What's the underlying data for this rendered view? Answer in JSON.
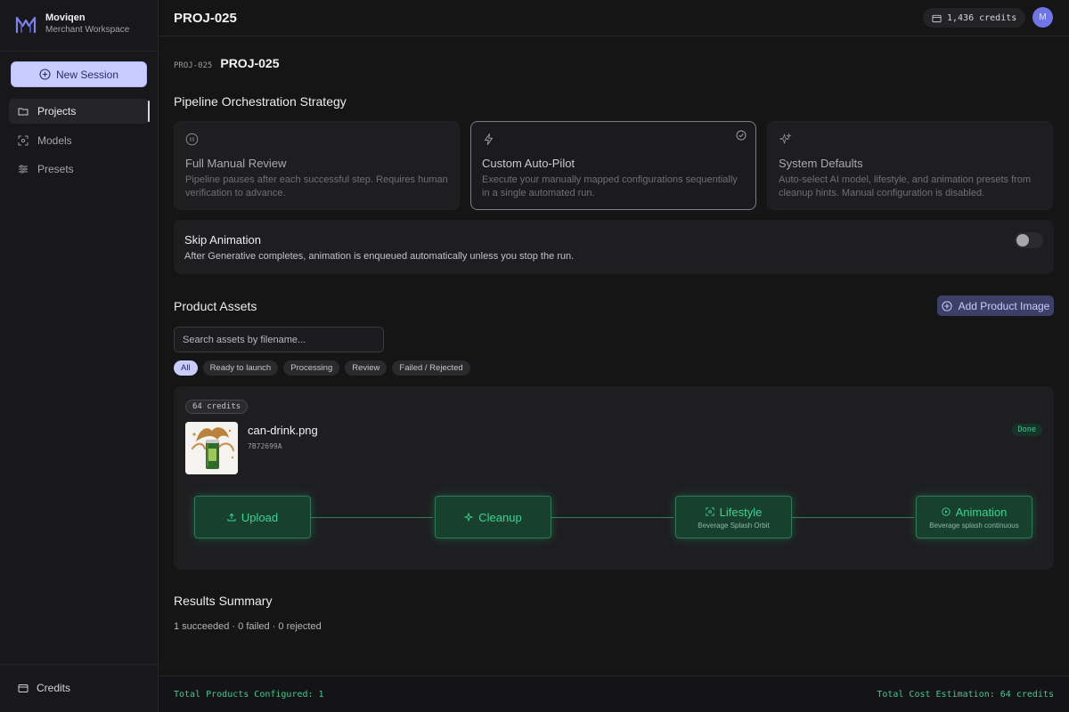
{
  "brand": {
    "name": "Moviqen",
    "subtitle": "Merchant Workspace"
  },
  "sidebar": {
    "new_session_label": "New Session",
    "items": [
      {
        "label": "Projects",
        "icon": "folder-icon",
        "active": true
      },
      {
        "label": "Models",
        "icon": "scan-icon",
        "active": false
      },
      {
        "label": "Presets",
        "icon": "sliders-icon",
        "active": false
      }
    ],
    "credits_label": "Credits"
  },
  "topbar": {
    "title": "PROJ-025",
    "credits": "1,436 credits",
    "avatar_initial": "M"
  },
  "breadcrumb": {
    "code": "PROJ-025",
    "title": "PROJ-025"
  },
  "strategy": {
    "title": "Pipeline Orchestration Strategy",
    "options": [
      {
        "title": "Full Manual Review",
        "description": "Pipeline pauses after each successful step. Requires human verification to advance.",
        "icon": "pause-icon",
        "selected": false
      },
      {
        "title": "Custom Auto-Pilot",
        "description": "Execute your manually mapped configurations sequentially in a single automated run.",
        "icon": "lightning-icon",
        "selected": true
      },
      {
        "title": "System Defaults",
        "description": "Auto-select AI model, lifestyle, and animation presets from cleanup hints. Manual configuration is disabled.",
        "icon": "sparkles-icon",
        "selected": false
      }
    ]
  },
  "skip_animation": {
    "title": "Skip Animation",
    "description": "After Generative completes, animation is enqueued automatically unless you stop the run.",
    "enabled": false
  },
  "assets": {
    "title": "Product Assets",
    "add_label": "Add Product Image",
    "search_placeholder": "Search assets by filename...",
    "filters": [
      "All",
      "Ready to launch",
      "Processing",
      "Review",
      "Failed / Rejected"
    ],
    "active_filter": "All",
    "items": [
      {
        "cost": "64 credits",
        "filename": "can-drink.png",
        "id": "7B72699A",
        "status": "Done",
        "steps": [
          {
            "label": "Upload",
            "sub": "",
            "icon": "upload-icon"
          },
          {
            "label": "Cleanup",
            "sub": "",
            "icon": "sparkle-icon"
          },
          {
            "label": "Lifestyle",
            "sub": "Beverage Splash Orbit",
            "icon": "scan-icon"
          },
          {
            "label": "Animation",
            "sub": "Beverage splash continuous",
            "icon": "play-icon"
          }
        ]
      }
    ]
  },
  "results": {
    "title": "Results Summary",
    "line": "1 succeeded · 0 failed · 0 rejected"
  },
  "footer": {
    "left": "Total Products Configured: 1",
    "right": "Total Cost Estimation: 64 credits"
  },
  "colors": {
    "accent": "#c9ccff",
    "success": "#3fc98f",
    "background": "#151516",
    "card": "#1e1e20"
  }
}
